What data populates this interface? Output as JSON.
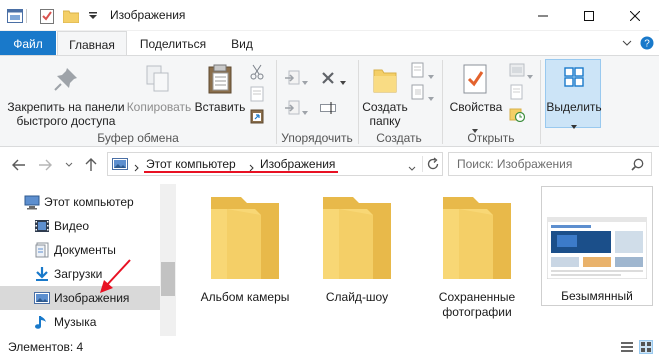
{
  "window": {
    "title": "Изображения",
    "controls": [
      "minimize-icon",
      "maximize-icon",
      "close-icon"
    ]
  },
  "quick_access": {
    "icons": [
      "explorer-icon",
      "properties-checklist-icon",
      "new-folder-icon",
      "customize-dropdown-icon"
    ]
  },
  "ribbon_tabs": {
    "file": "Файл",
    "home": "Главная",
    "share": "Поделиться",
    "view": "Вид",
    "active": "Главная"
  },
  "ribbon": {
    "pin_label_line1": "Закрепить на панели",
    "pin_label_line2": "быстрого доступа",
    "copy_label": "Копировать",
    "paste_label": "Вставить",
    "clipboard_group": "Буфер обмена",
    "organize_group": "Упорядочить",
    "new_folder_line1": "Создать",
    "new_folder_line2": "папку",
    "new_group": "Создать",
    "properties_label": "Свойства",
    "open_group": "Открыть",
    "select_label": "Выделить"
  },
  "address": {
    "crumbs": [
      "Этот компьютер",
      "Изображения"
    ],
    "search_placeholder": "Поиск: Изображения"
  },
  "nav_pane": {
    "items": [
      {
        "label": "Этот компьютер",
        "icon": "computer-icon",
        "selected": false
      },
      {
        "label": "Видео",
        "icon": "video-icon",
        "selected": false
      },
      {
        "label": "Документы",
        "icon": "documents-icon",
        "selected": false
      },
      {
        "label": "Загрузки",
        "icon": "downloads-icon",
        "selected": false
      },
      {
        "label": "Изображения",
        "icon": "pictures-icon",
        "selected": true
      },
      {
        "label": "Музыка",
        "icon": "music-icon",
        "selected": false
      }
    ]
  },
  "content": {
    "items": [
      {
        "label": "Альбом камеры",
        "type": "folder"
      },
      {
        "label": "Слайд-шоу",
        "type": "folder"
      },
      {
        "label": "Сохраненные фотографии",
        "type": "folder"
      },
      {
        "label": "Безымянный",
        "type": "image"
      }
    ]
  },
  "status": {
    "items_count": "Элементов: 4"
  },
  "colors": {
    "file_tab": "#1979ca",
    "selection": "#cce4f7",
    "folder": "#f4cf67",
    "annotation": "#e81123"
  }
}
